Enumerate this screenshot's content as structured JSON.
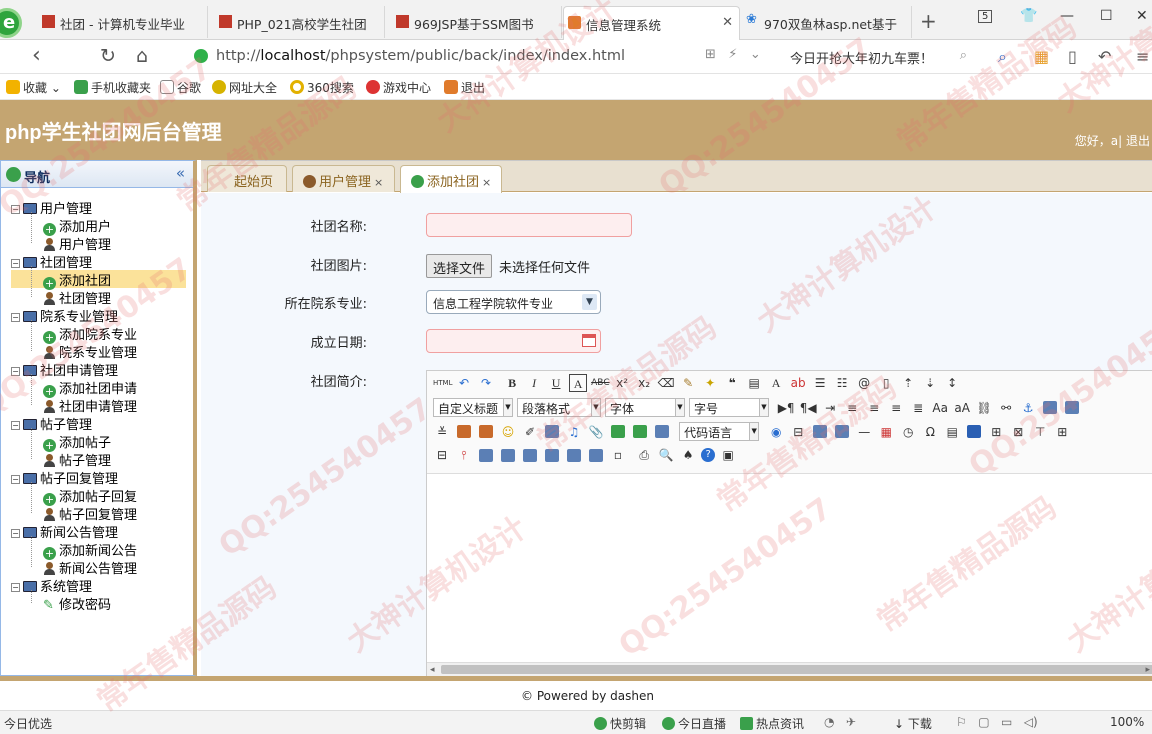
{
  "browser": {
    "tabs": [
      {
        "label": "社团 - 计算机专业毕业"
      },
      {
        "label": "PHP_021高校学生社团"
      },
      {
        "label": "969JSP基于SSM图书"
      },
      {
        "label": "信息管理系统",
        "active": true
      },
      {
        "label": "970双鱼林asp.net基于"
      }
    ],
    "tab_count": "5",
    "url_prefix": "http://",
    "url_host": "localhost",
    "url_path": "/phpsystem/public/back/index/index.html",
    "search_text": "今日开抢大年初九车票！",
    "bookmarks": [
      "收藏",
      "手机收藏夹",
      "谷歌",
      "网址大全",
      "360搜索",
      "游戏中心",
      "退出"
    ]
  },
  "app": {
    "title": "php学生社团网后台管理",
    "greeting": "您好，a| 退出"
  },
  "sidebar": {
    "title": "导航",
    "groups": [
      {
        "label": "用户管理",
        "items": [
          "添加用户",
          "用户管理"
        ]
      },
      {
        "label": "社团管理",
        "items": [
          "添加社团",
          "社团管理"
        ]
      },
      {
        "label": "院系专业管理",
        "items": [
          "添加院系专业",
          "院系专业管理"
        ]
      },
      {
        "label": "社团申请管理",
        "items": [
          "添加社团申请",
          "社团申请管理"
        ]
      },
      {
        "label": "帖子管理",
        "items": [
          "添加帖子",
          "帖子管理"
        ]
      },
      {
        "label": "帖子回复管理",
        "items": [
          "添加帖子回复",
          "帖子回复管理"
        ]
      },
      {
        "label": "新闻公告管理",
        "items": [
          "添加新闻公告",
          "新闻公告管理"
        ]
      },
      {
        "label": "系统管理",
        "items": [
          "修改密码"
        ]
      }
    ],
    "selected": "添加社团"
  },
  "page_tabs": [
    {
      "label": "起始页"
    },
    {
      "label": "用户管理",
      "close": "×"
    },
    {
      "label": "添加社团",
      "close": "×",
      "active": true
    }
  ],
  "form": {
    "name_label": "社团名称:",
    "name_value": "",
    "image_label": "社团图片:",
    "file_button": "选择文件",
    "file_status": "未选择任何文件",
    "dept_label": "所在院系专业:",
    "dept_value": "信息工程学院软件专业",
    "date_label": "成立日期:",
    "date_value": "",
    "intro_label": "社团简介:"
  },
  "editor": {
    "dropdowns": [
      "自定义标题",
      "段落格式",
      "字体",
      "字号",
      "代码语言"
    ],
    "html_label": "HTML"
  },
  "footer": {
    "text": "© Powered by dashen"
  },
  "statusbar": {
    "left": "今日优选",
    "items": [
      "快剪辑",
      "今日直播",
      "热点资讯",
      "下载"
    ],
    "zoom": "100%"
  },
  "watermark": {
    "texts": [
      "QQ:254540457",
      "常年售精品源码",
      "大神计算机设计"
    ]
  },
  "colors": {
    "header": "#c4a571",
    "selected": "#fbe29a",
    "required_field": "#fdeeef"
  }
}
